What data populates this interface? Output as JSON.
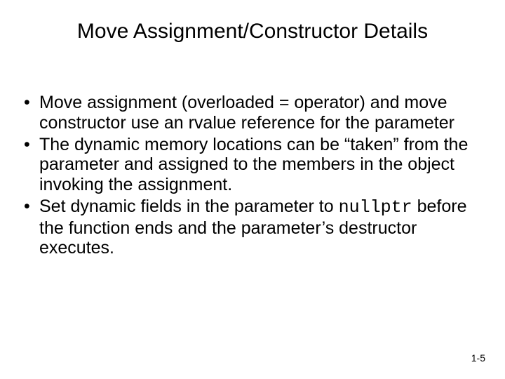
{
  "title": "Move Assignment/Constructor Details",
  "bullets": [
    {
      "text_a": "Move assignment (overloaded = operator) and move constructor use an rvalue reference for the parameter"
    },
    {
      "text_a": "The dynamic memory locations can be “taken” from the parameter and assigned to the members in the object invoking the assignment."
    },
    {
      "text_a": "Set dynamic fields in the parameter to ",
      "code": "nullptr",
      "text_b": " before the function ends and the parameter’s destructor executes."
    }
  ],
  "page": "1-5",
  "dot": "•"
}
